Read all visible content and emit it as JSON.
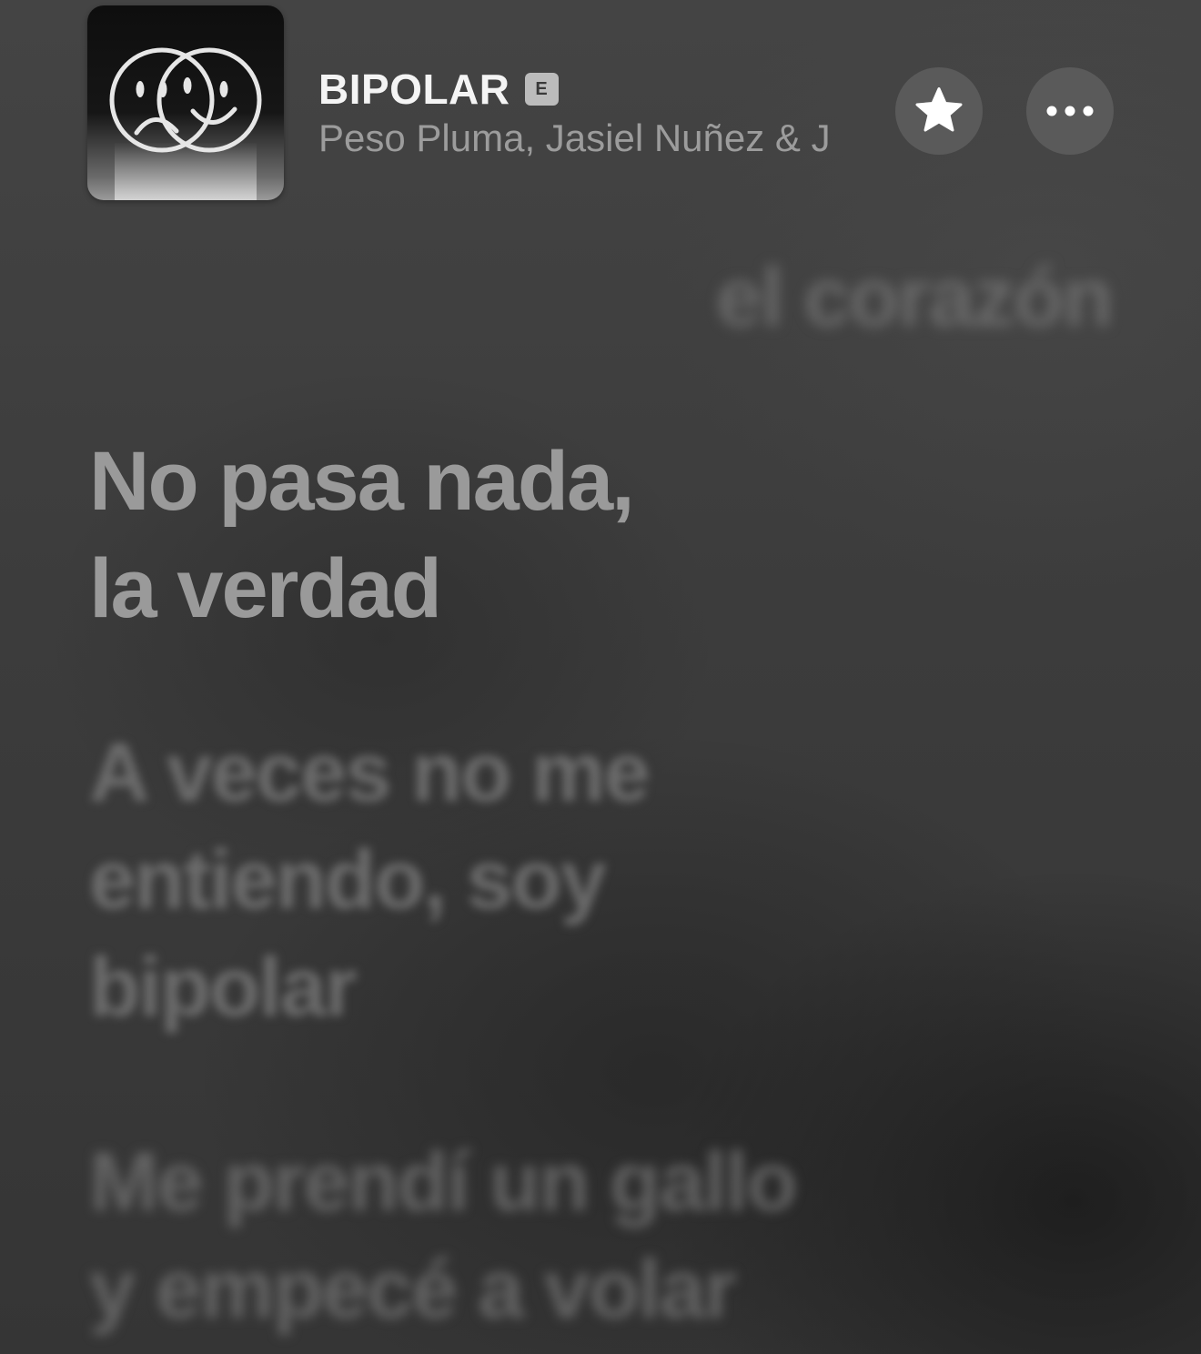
{
  "now_playing": {
    "title": "BIPOLAR",
    "explicit_badge": "E",
    "artists": "Peso Pluma, Jasiel Nuñez & J"
  },
  "icons": {
    "favorite": "star-icon",
    "more": "ellipsis-icon",
    "artwork": "album-artwork"
  },
  "lyrics": {
    "previous_line": [
      "el corazón"
    ],
    "current_line": [
      "No pasa nada,",
      "la verdad"
    ],
    "next_lines": [
      [
        "A veces no me",
        "entiendo, soy",
        "bipolar"
      ],
      [
        "Me prendí un gallo",
        "y empecé a volar"
      ]
    ]
  },
  "colors": {
    "background": "#3b3b3b",
    "button": "#5a5a5a",
    "title": "#f4f4f4",
    "artist": "#9c9c9c",
    "current_lyric": "#9a9a9a"
  }
}
